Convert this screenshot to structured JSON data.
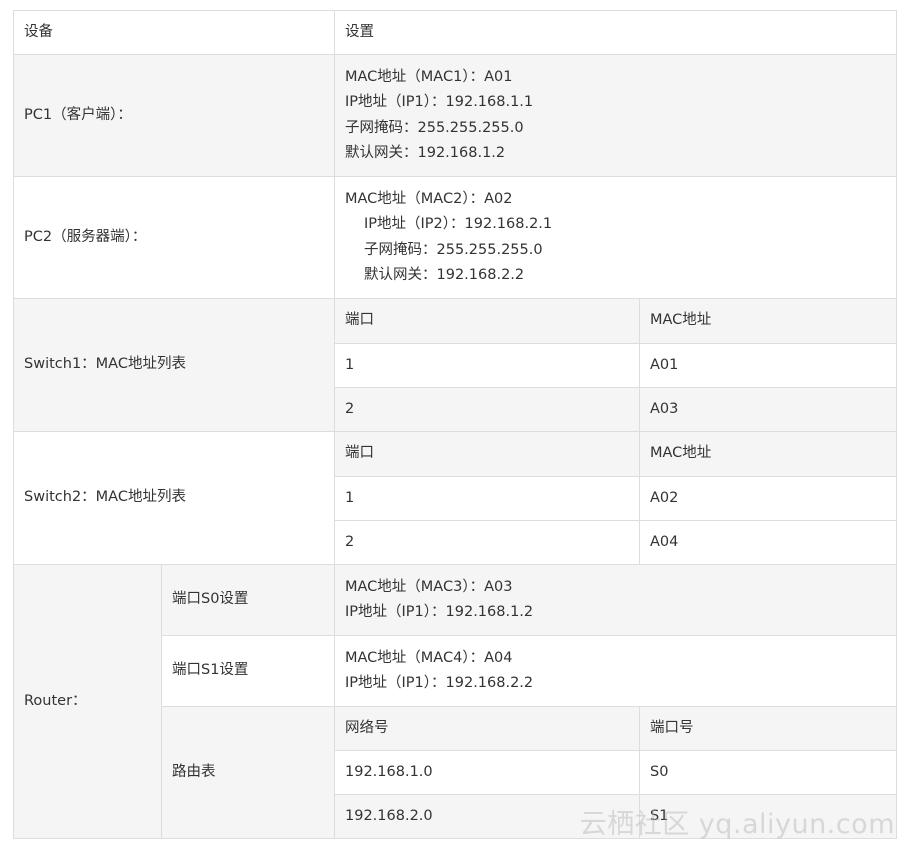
{
  "header": {
    "col1": "设备",
    "col2": "设置"
  },
  "pc1": {
    "label": "PC1（客户端）：",
    "lines": [
      "MAC地址（MAC1）：A01",
      "IP地址（IP1）：192.168.1.1",
      "子网掩码：255.255.255.0",
      "默认网关：192.168.1.2"
    ]
  },
  "pc2": {
    "label": "PC2（服务器端）：",
    "lines": [
      "MAC地址（MAC2）：A02",
      "IP地址（IP2）：192.168.2.1",
      "子网掩码：255.255.255.0",
      "默认网关：192.168.2.2"
    ]
  },
  "switch1": {
    "label": "Switch1：MAC地址列表",
    "headers": [
      "端口",
      "MAC地址"
    ],
    "rows": [
      [
        "1",
        "A01"
      ],
      [
        "2",
        "A03"
      ]
    ]
  },
  "switch2": {
    "label": "Switch2：MAC地址列表",
    "headers": [
      "端口",
      "MAC地址"
    ],
    "rows": [
      [
        "1",
        "A02"
      ],
      [
        "2",
        "A04"
      ]
    ]
  },
  "router": {
    "label": "Router：",
    "s0": {
      "label": "端口S0设置",
      "lines": [
        "MAC地址（MAC3）：A03",
        "IP地址（IP1）：192.168.1.2"
      ]
    },
    "s1": {
      "label": "端口S1设置",
      "lines": [
        "MAC地址（MAC4）：A04",
        "IP地址（IP1）：192.168.2.2"
      ]
    },
    "routing": {
      "label": "路由表",
      "headers": [
        "网络号",
        "端口号"
      ],
      "rows": [
        [
          "192.168.1.0",
          "S0"
        ],
        [
          "192.168.2.0",
          "S1"
        ]
      ]
    }
  },
  "watermark": "云栖社区 yq.aliyun.com"
}
